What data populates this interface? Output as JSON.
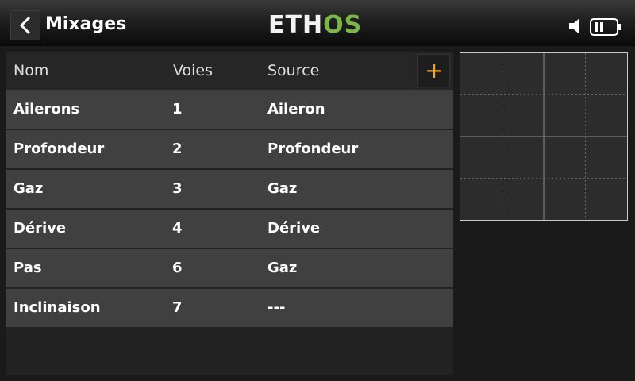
{
  "header": {
    "title": "Mixages",
    "logo_part1": "ETH",
    "logo_part2": "OS"
  },
  "table": {
    "columns": [
      "Nom",
      "Voies",
      "Source"
    ],
    "add_label": "+",
    "rows": [
      {
        "nom": "Ailerons",
        "voies": "1",
        "source": "Aileron"
      },
      {
        "nom": "Profondeur",
        "voies": "2",
        "source": "Profondeur"
      },
      {
        "nom": "Gaz",
        "voies": "3",
        "source": "Gaz"
      },
      {
        "nom": "Dérive",
        "voies": "4",
        "source": "Dérive"
      },
      {
        "nom": "Pas",
        "voies": "6",
        "source": "Gaz"
      },
      {
        "nom": "Inclinaison",
        "voies": "7",
        "source": "---"
      }
    ]
  },
  "icons": {
    "back": "chevron-left-icon",
    "speaker": "speaker-icon",
    "battery": "battery-icon",
    "add": "plus-icon"
  },
  "colors": {
    "accent": "#f5a623",
    "logo_green": "#7ab648",
    "row_bg": "#404040"
  }
}
